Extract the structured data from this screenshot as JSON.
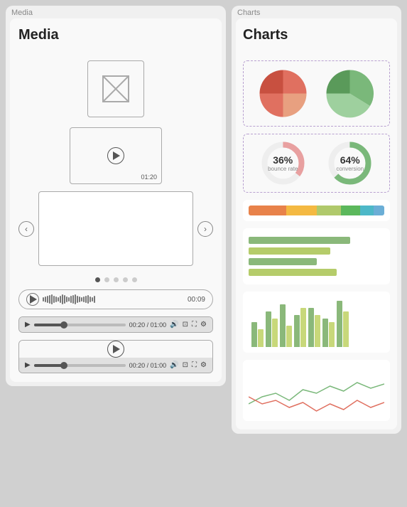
{
  "media_panel": {
    "label": "Media",
    "title": "Media",
    "video_thumb_duration": "01:20",
    "carousel_dots": [
      true,
      false,
      false,
      false,
      false
    ],
    "audio_time": "00:09",
    "video1_time": "00:20 / 01:00",
    "video2_time": "00:20 / 01:00",
    "arrow_left": "‹",
    "arrow_right": "›"
  },
  "charts_panel": {
    "label": "Charts",
    "title": "Charts",
    "donut1": {
      "pct": "36%",
      "sub": "bounce rate"
    },
    "donut2": {
      "pct": "64%",
      "sub": "conversion"
    },
    "progress_segments": [
      {
        "color": "#e8824a",
        "width": 28
      },
      {
        "color": "#f4b942",
        "width": 22
      },
      {
        "color": "#b0c96b",
        "width": 18
      },
      {
        "color": "#5cb85c",
        "width": 14
      },
      {
        "color": "#4db8c8",
        "width": 10
      },
      {
        "color": "#6baed6",
        "width": 8
      }
    ],
    "hbars": [
      {
        "color": "#8ab87a",
        "width": 75
      },
      {
        "color": "#b5cc6a",
        "width": 60
      },
      {
        "color": "#8ab87a",
        "width": 50
      },
      {
        "color": "#b5cc6a",
        "width": 65
      }
    ],
    "vbar_groups": [
      [
        {
          "color": "#8ab87a",
          "h": 35
        },
        {
          "color": "#c8d87a",
          "h": 25
        }
      ],
      [
        {
          "color": "#8ab87a",
          "h": 50
        },
        {
          "color": "#c8d87a",
          "h": 40
        }
      ],
      [
        {
          "color": "#8ab87a",
          "h": 60
        },
        {
          "color": "#c8d87a",
          "h": 30
        }
      ],
      [
        {
          "color": "#8ab87a",
          "h": 45
        },
        {
          "color": "#c8d87a",
          "h": 55
        }
      ],
      [
        {
          "color": "#8ab87a",
          "h": 55
        },
        {
          "color": "#c8d87a",
          "h": 45
        }
      ],
      [
        {
          "color": "#8ab87a",
          "h": 40
        },
        {
          "color": "#c8d87a",
          "h": 35
        }
      ],
      [
        {
          "color": "#8ab87a",
          "h": 65
        },
        {
          "color": "#c8d87a",
          "h": 50
        }
      ]
    ]
  }
}
